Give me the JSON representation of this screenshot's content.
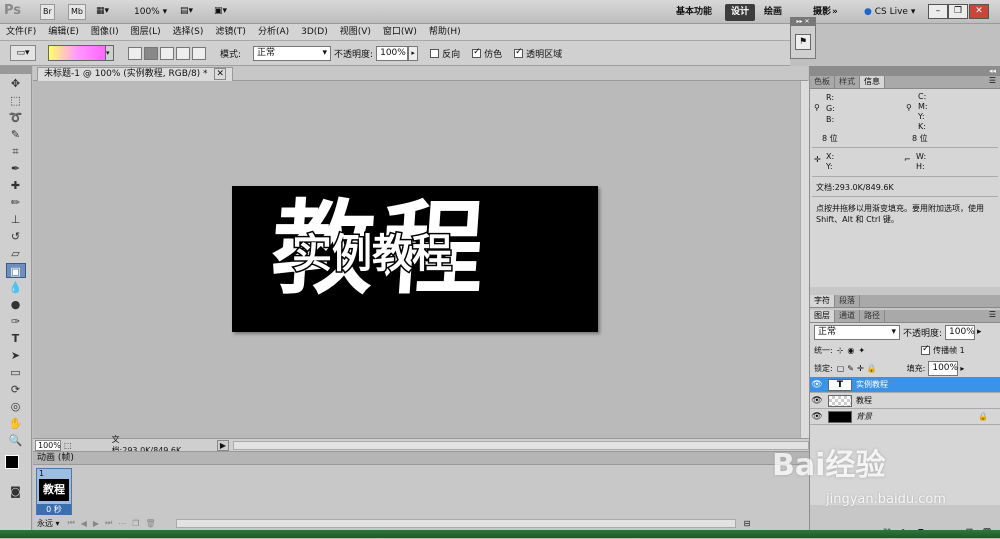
{
  "appbar": {
    "logo": "Ps",
    "br": "Br",
    "mb": "Mb",
    "zoom": "100%",
    "workspaces": [
      "基本功能",
      "设计",
      "绘画",
      "摄影"
    ],
    "active_workspace": "设计",
    "more": "»",
    "cslive": "CS Live"
  },
  "menu": [
    "文件(F)",
    "编辑(E)",
    "图像(I)",
    "图层(L)",
    "选择(S)",
    "滤镜(T)",
    "分析(A)",
    "3D(D)",
    "视图(V)",
    "窗口(W)",
    "帮助(H)"
  ],
  "options": {
    "mode_label": "模式:",
    "mode_value": "正常",
    "opacity_label": "不透明度:",
    "opacity_value": "100%",
    "reverse": "反向",
    "dither": "仿色",
    "transparency": "透明区域"
  },
  "document": {
    "tab_title": "未标题-1 @ 100% (实例教程, RGB/8) *",
    "big_text": "教程",
    "small_text": "实例教程",
    "zoom": "100%",
    "doc_info": "文档:293.0K/849.6K"
  },
  "animation": {
    "title": "动画 (帧)",
    "frame_num": "1",
    "frame_thumb": "教程",
    "frame_delay": "0 秒",
    "loop": "永远"
  },
  "info_panel": {
    "tabs": [
      "色板",
      "样式",
      "信息"
    ],
    "rgb": [
      "R:",
      "G:",
      "B:"
    ],
    "cmyk": [
      "C:",
      "M:",
      "Y:",
      "K:"
    ],
    "bit_left": "8 位",
    "bit_right": "8 位",
    "xy": [
      "X:",
      "Y:"
    ],
    "wh": [
      "W:",
      "H:"
    ],
    "doc": "文档:293.0K/849.6K",
    "hint": "点按并拖移以用渐变填充。要用附加选项，使用 Shift、Alt 和 Ctrl 键。"
  },
  "char_tabs": [
    "字符",
    "段落"
  ],
  "layers_panel": {
    "tabs": [
      "图层",
      "通道",
      "路径"
    ],
    "blend": "正常",
    "opacity_label": "不透明度:",
    "opacity_value": "100%",
    "unify": "统一:",
    "propagate": "传播帧 1",
    "lock": "锁定:",
    "fill_label": "填充:",
    "fill_value": "100%",
    "layers": [
      {
        "name": "实例教程",
        "type": "T"
      },
      {
        "name": "教程",
        "type": "transparent"
      },
      {
        "name": "背景",
        "type": "black"
      }
    ]
  },
  "watermark": {
    "brand": "Bai经验",
    "url": "jingyan.baidu.com"
  }
}
